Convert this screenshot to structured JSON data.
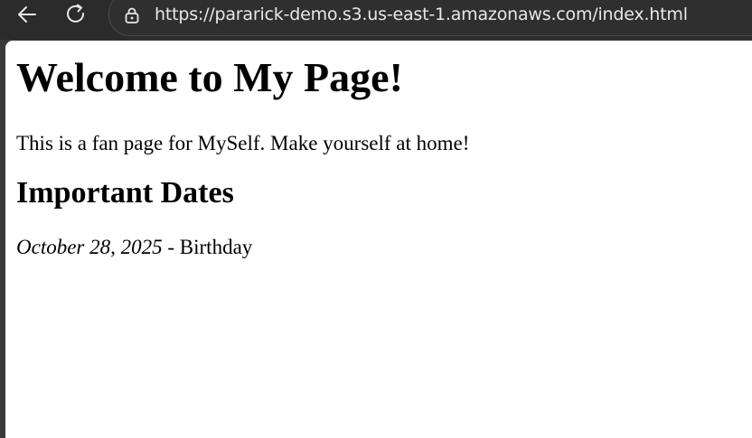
{
  "browser": {
    "url": "https://pararick-demo.s3.us-east-1.amazonaws.com/index.html"
  },
  "page": {
    "heading": "Welcome to My Page!",
    "intro": "This is a fan page for MySelf. Make yourself at home!",
    "section_heading": "Important Dates",
    "dates": [
      {
        "date": "October 28, 2025",
        "separator": " - ",
        "event": "Birthday"
      }
    ]
  }
}
